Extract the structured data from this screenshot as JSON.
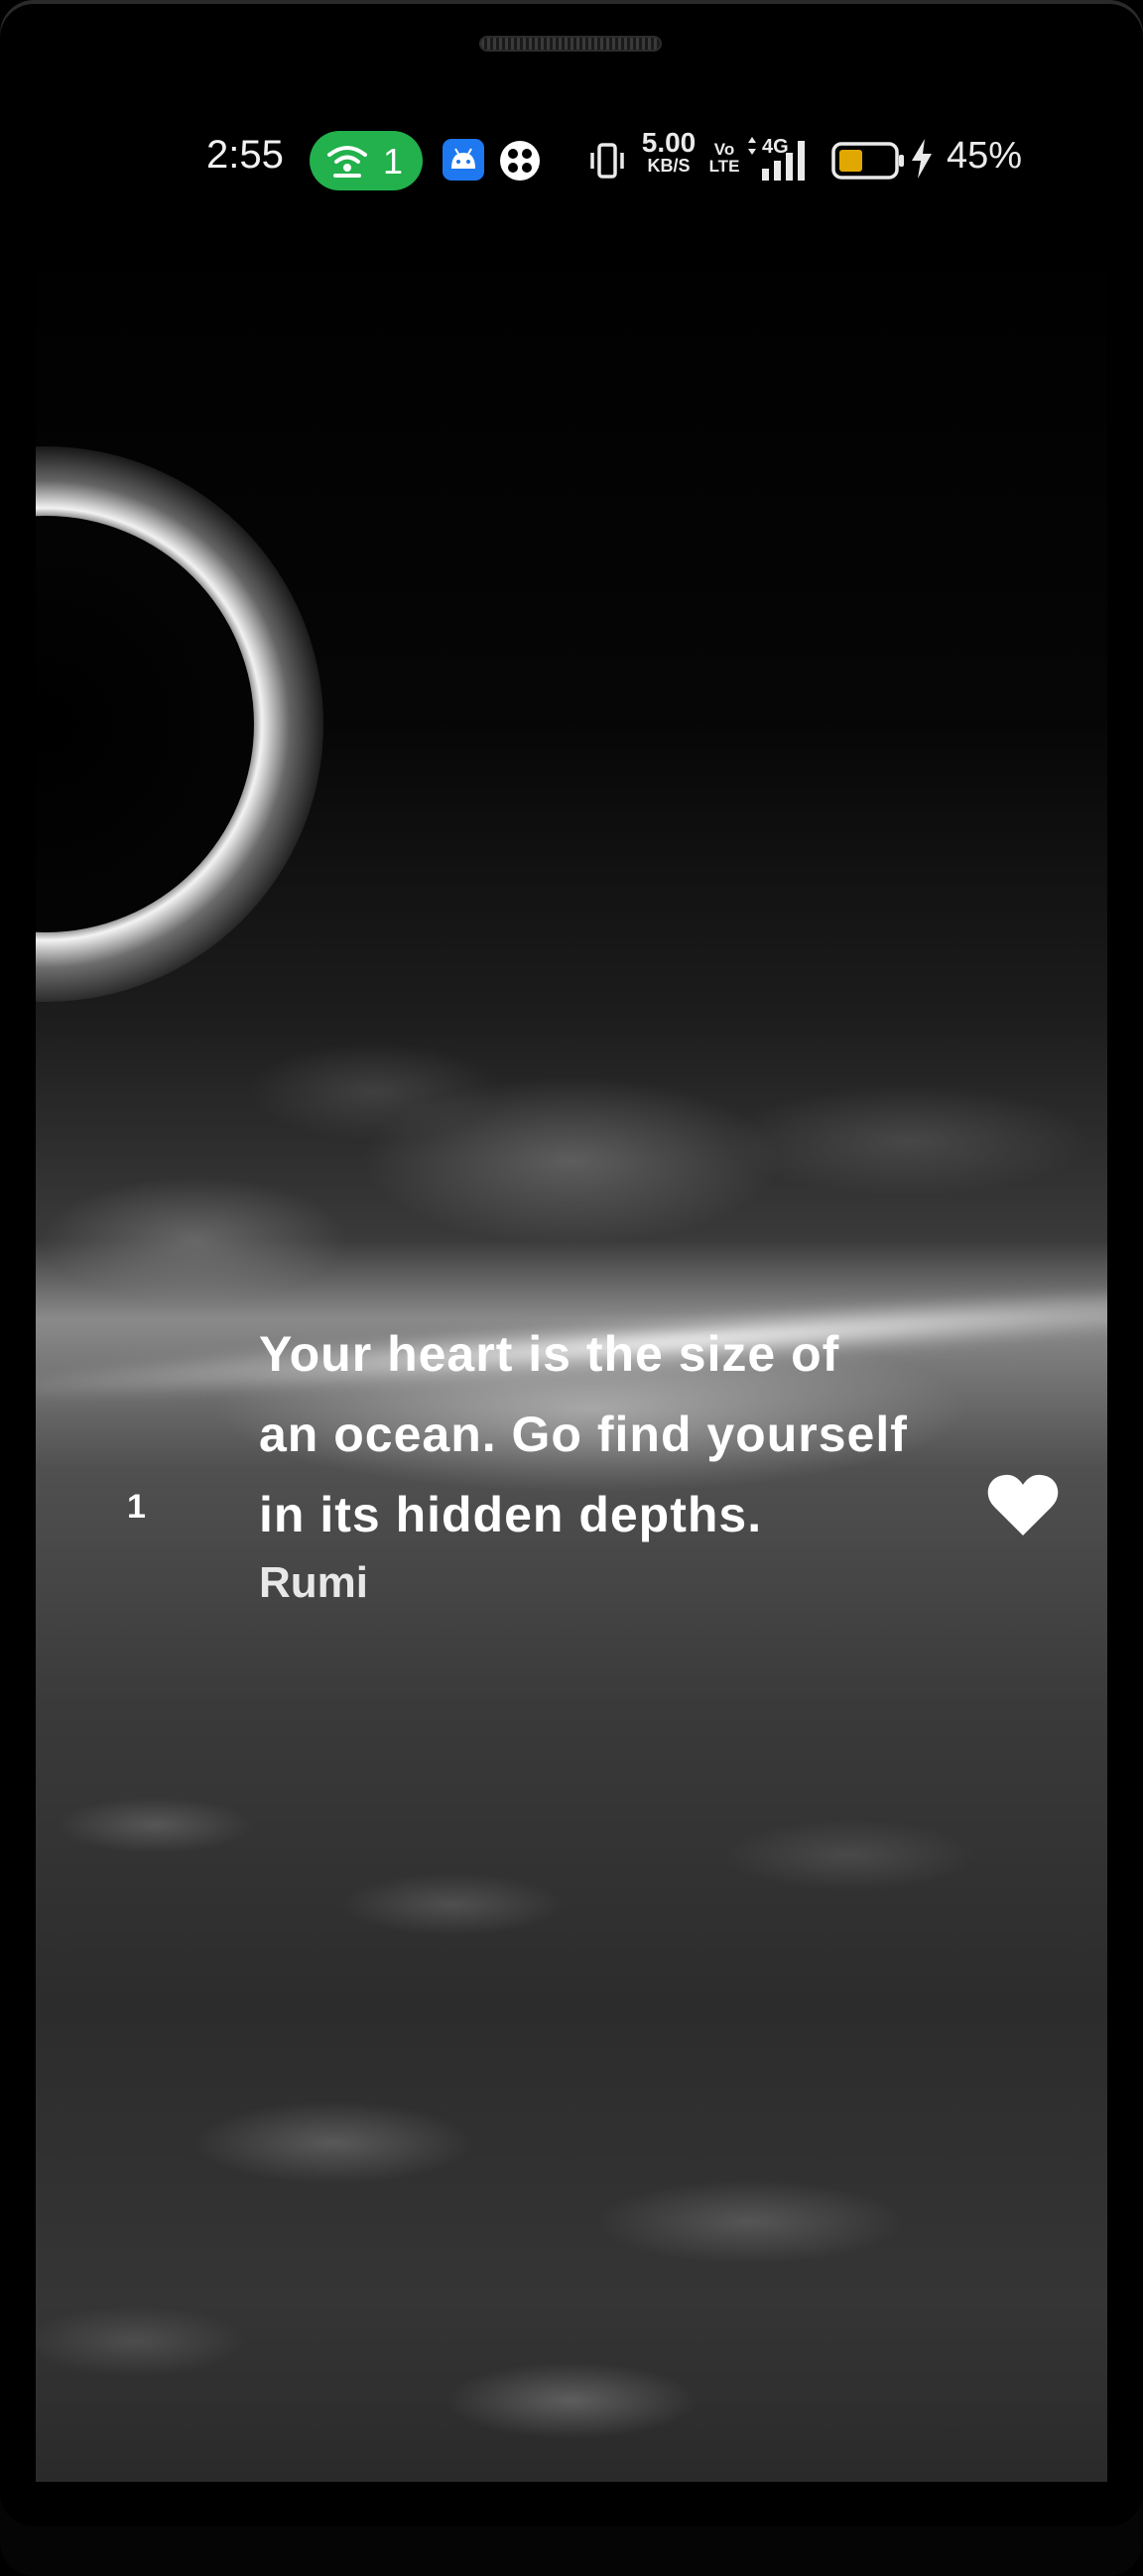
{
  "status_bar": {
    "time": "2:55",
    "hotspot_count": "1",
    "network_speed_value": "5.00",
    "network_speed_unit": "KB/S",
    "volte_top": "Vo",
    "volte_bottom": "LTE",
    "network_type": "4G",
    "battery_percent": "45%",
    "battery_level": 0.45,
    "icons": [
      "hotspot-icon",
      "android-icon",
      "clover-icon",
      "vibrate-icon",
      "signal-icon",
      "battery-icon",
      "charging-bolt-icon"
    ],
    "colors": {
      "hotspot_pill": "#22b14c",
      "android_badge": "#1e78f0",
      "battery_fill": "#e0a800"
    }
  },
  "quote": {
    "index": "1",
    "text": "Your heart is the size of an ocean. Go find yourself in its hidden depths.",
    "author": "Rumi",
    "favorite_icon": "heart-icon"
  }
}
